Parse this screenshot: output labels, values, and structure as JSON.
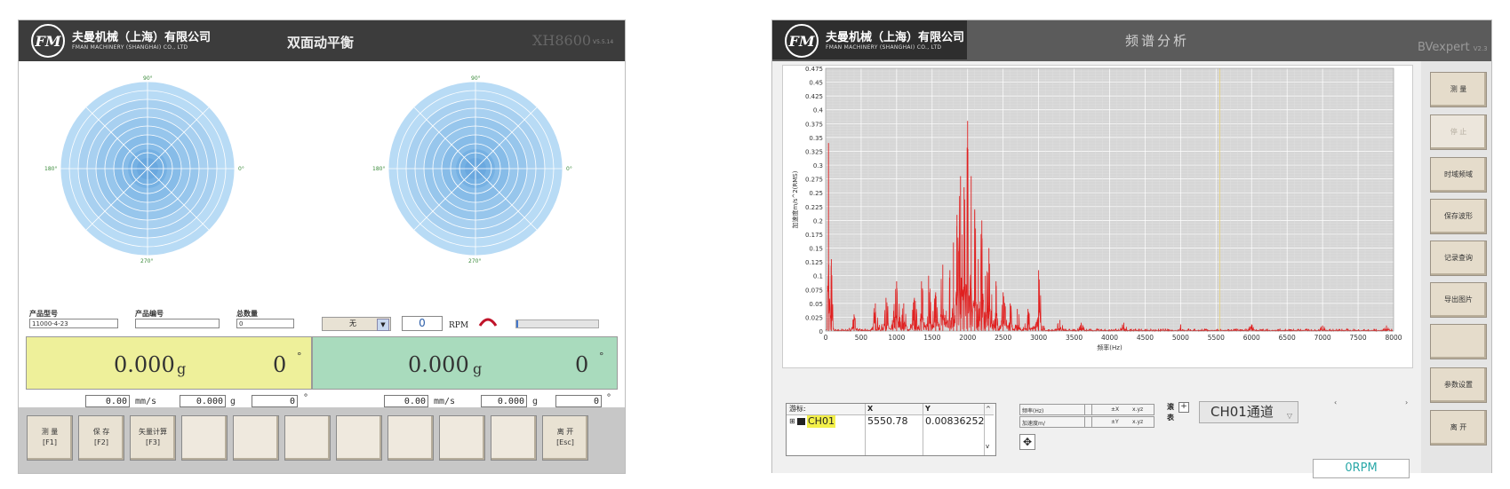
{
  "left_window": {
    "company_cn": "夫曼机械（上海）有限公司",
    "company_en": "FMAN MACHINERY (SHANGHAI) CO., LTD",
    "logo": "FM",
    "title": "双面动平衡",
    "model": "XH8600",
    "version": "V5.5.14",
    "polar_angles": {
      "top": "90°",
      "left": "180°",
      "right": "0°",
      "bottom": "270°"
    },
    "fields": {
      "product_model_label": "产品型号",
      "product_model_value": "11000-4-23",
      "product_number_label": "产品编号",
      "product_number_value": "",
      "total_label": "总数量",
      "total_value": "0",
      "select_value": "无",
      "rpm_value": "0",
      "rpm_unit": "RPM"
    },
    "plane1": {
      "amplitude": "0.000",
      "unit": "g",
      "angle": "0",
      "deg": "°",
      "velocity": "0.00",
      "velocity_unit": "mm/s",
      "accel": "0.000",
      "accel_unit": "g",
      "phase": "0",
      "phase_unit": "°"
    },
    "plane2": {
      "amplitude": "0.000",
      "unit": "g",
      "angle": "0",
      "deg": "°",
      "velocity": "0.00",
      "velocity_unit": "mm/s",
      "accel": "0.000",
      "accel_unit": "g",
      "phase": "0",
      "phase_unit": "°"
    },
    "buttons": [
      {
        "label": "测 量",
        "key": "[F1]"
      },
      {
        "label": "保 存",
        "key": "[F2]"
      },
      {
        "label": "矢量计算",
        "key": "[F3]"
      },
      {
        "label": "",
        "key": ""
      },
      {
        "label": "",
        "key": ""
      },
      {
        "label": "",
        "key": ""
      },
      {
        "label": "",
        "key": ""
      },
      {
        "label": "",
        "key": ""
      },
      {
        "label": "",
        "key": ""
      },
      {
        "label": "",
        "key": ""
      },
      {
        "label": "离 开",
        "key": "[Esc]"
      }
    ],
    "colors": {
      "plane1": "#eef09a",
      "plane2": "#a9dbbd",
      "polar": "#a9d3f1"
    }
  },
  "right_window": {
    "company_cn": "夫曼机械（上海）有限公司",
    "company_en": "FMAN MACHINERY (SHANGHAI) CO., LTD",
    "logo": "FM",
    "title": "频谱分析",
    "brand": "BVexpert",
    "brand_version": "V2.3",
    "side_buttons": [
      {
        "label": "测  量",
        "enabled": true
      },
      {
        "label": "停  止",
        "enabled": false
      },
      {
        "label": "时域频域",
        "enabled": true
      },
      {
        "label": "保存波形",
        "enabled": true
      },
      {
        "label": "记录查询",
        "enabled": true
      },
      {
        "label": "导出图片",
        "enabled": true
      },
      {
        "label": "",
        "enabled": true
      },
      {
        "label": "参数设置",
        "enabled": true
      },
      {
        "label": "离  开",
        "enabled": true
      }
    ],
    "cursor_table": {
      "headers": [
        "游标:",
        "X",
        "Y"
      ],
      "row": {
        "name": "CH01",
        "x": "5550.78",
        "y": "0.00836252"
      }
    },
    "controls": {
      "freq_label": "频率(Hz)",
      "accel_label": "加速度m/",
      "mode_label": "滚表"
    },
    "channel": "CH01通道",
    "rpm": "0RPM"
  },
  "chart_data": {
    "type": "line",
    "xlabel": "频率(Hz)",
    "ylabel": "加速度m/s^2(RMS)",
    "xlim": [
      0,
      8000
    ],
    "ylim": [
      0,
      0.475
    ],
    "x_ticks": [
      "0",
      "500",
      "1000",
      "1500",
      "2000",
      "2500",
      "3000",
      "3500",
      "4000",
      "4500",
      "5000",
      "5500",
      "6000",
      "6500",
      "7000",
      "7500",
      "8000"
    ],
    "y_ticks": [
      "0",
      "0.025",
      "0.05",
      "0.075",
      "0.1",
      "0.125",
      "0.15",
      "0.175",
      "0.2",
      "0.225",
      "0.25",
      "0.275",
      "0.3",
      "0.325",
      "0.35",
      "0.375",
      "0.4",
      "0.425",
      "0.45",
      "0.475"
    ],
    "grid": true,
    "cursor_x": 5550.78,
    "series": [
      {
        "color": "#e02020",
        "peaks": [
          [
            40,
            0.34
          ],
          [
            80,
            0.13
          ],
          [
            400,
            0.03
          ],
          [
            700,
            0.05
          ],
          [
            850,
            0.06
          ],
          [
            1000,
            0.09
          ],
          [
            1100,
            0.05
          ],
          [
            1250,
            0.06
          ],
          [
            1350,
            0.09
          ],
          [
            1450,
            0.1
          ],
          [
            1550,
            0.07
          ],
          [
            1650,
            0.12
          ],
          [
            1750,
            0.11
          ],
          [
            1800,
            0.16
          ],
          [
            1850,
            0.21
          ],
          [
            1900,
            0.28
          ],
          [
            1950,
            0.26
          ],
          [
            2000,
            0.38
          ],
          [
            2050,
            0.28
          ],
          [
            2100,
            0.22
          ],
          [
            2150,
            0.13
          ],
          [
            2200,
            0.2
          ],
          [
            2250,
            0.1
          ],
          [
            2300,
            0.15
          ],
          [
            2400,
            0.09
          ],
          [
            2500,
            0.07
          ],
          [
            2600,
            0.05
          ],
          [
            2700,
            0.04
          ],
          [
            2850,
            0.04
          ],
          [
            3000,
            0.11
          ],
          [
            3300,
            0.02
          ],
          [
            3600,
            0.015
          ],
          [
            4200,
            0.015
          ],
          [
            5000,
            0.012
          ],
          [
            6000,
            0.012
          ],
          [
            7000,
            0.01
          ],
          [
            7900,
            0.01
          ]
        ],
        "noise_floor": 0.004
      }
    ]
  }
}
